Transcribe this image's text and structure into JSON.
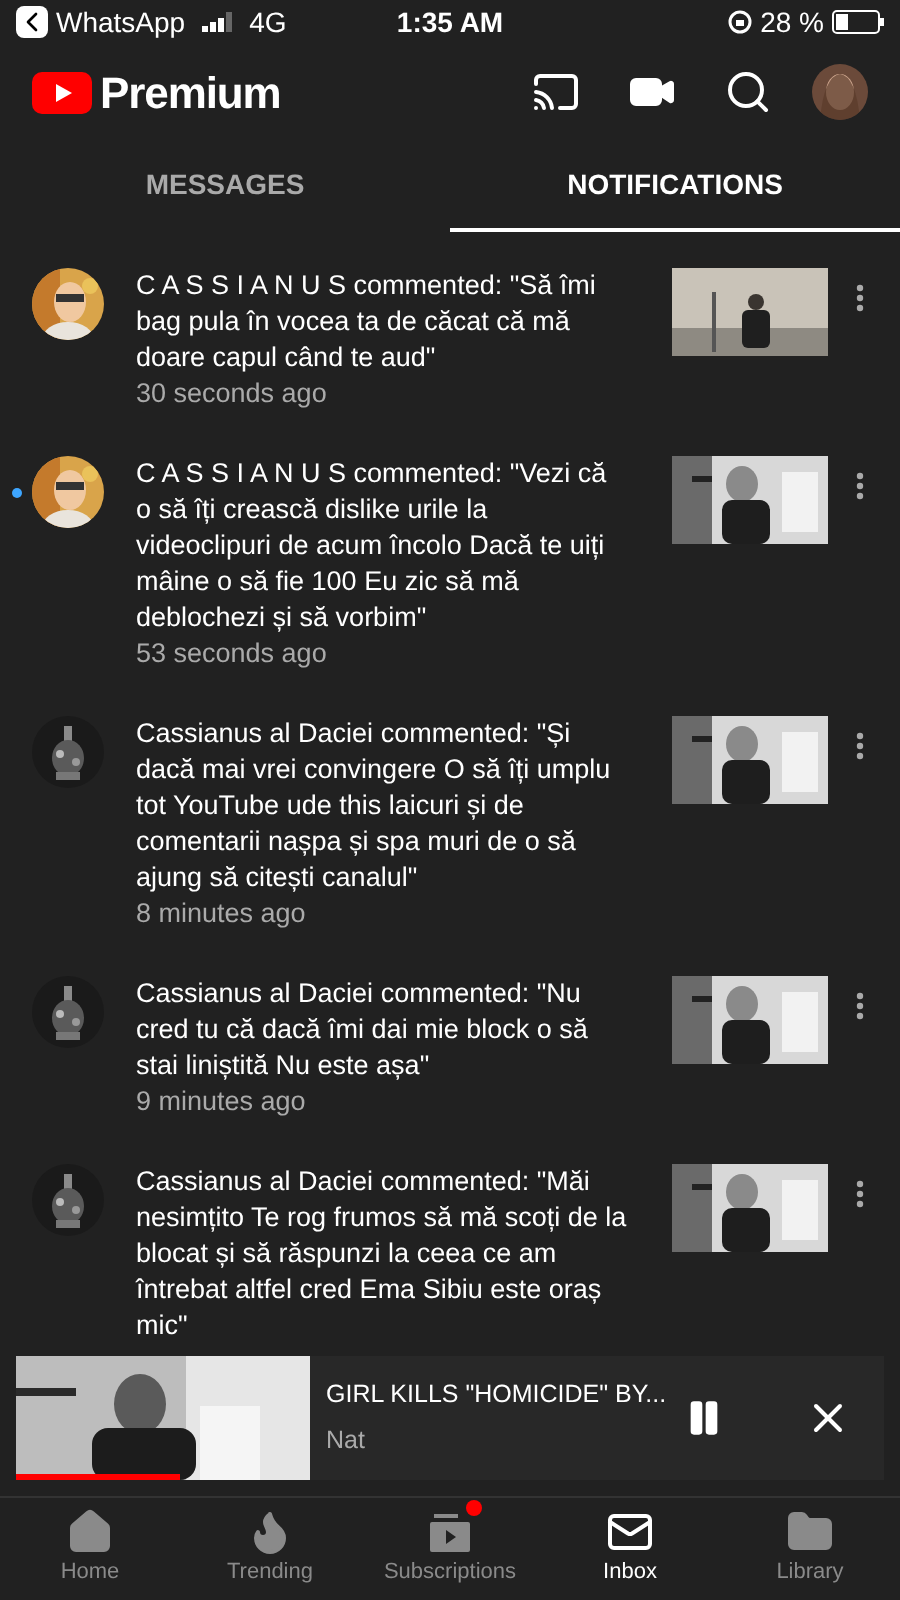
{
  "status_bar": {
    "back_app": "WhatsApp",
    "network": "4G",
    "time": "1:35 AM",
    "battery": "28 %"
  },
  "header": {
    "logo_text": "Premium"
  },
  "tabs": [
    {
      "label": "MESSAGES",
      "selected": false
    },
    {
      "label": "NOTIFICATIONS",
      "selected": true
    }
  ],
  "notifications": [
    {
      "author": "C A S S I A N U S",
      "text": " commented: \"Să îmi bag pula în vocea ta de căcat că mă doare capul când te aud\"",
      "time": "30 seconds ago",
      "unread": false
    },
    {
      "author": "C A S S I A N U S",
      "text": " commented: \"Vezi că o să îți crească dislike urile la videoclipuri de acum încolo Dacă te uiți mâine o să fie 100 Eu zic să mă deblochezi și să vorbim\"",
      "time": "53 seconds ago",
      "unread": true
    },
    {
      "author": "Cassianus al Daciei",
      "text": " commented: \"Și dacă mai vrei convingere O să îți umplu tot YouTube ude this laicuri și de comentarii nașpa și spa muri de o să ajung să citești canalul\"",
      "time": "8 minutes ago",
      "unread": false
    },
    {
      "author": "Cassianus al Daciei",
      "text": " commented: \"Nu cred tu că dacă îmi dai mie block o să stai liniștită Nu este așa\"",
      "time": "9 minutes ago",
      "unread": false
    },
    {
      "author": "Cassianus al Daciei",
      "text": " commented: \"Măi nesimțito Te rog frumos să mă scoți de la blocat și să răspunzi la ceea ce am întrebat altfel cred Ema Sibiu este oraș mic\"",
      "unread": false
    }
  ],
  "mini_player": {
    "title": "GIRL KILLS \"HOMICIDE\" BY...",
    "channel": "Nat"
  },
  "bottom_nav": [
    {
      "label": "Home",
      "selected": false,
      "badge": false
    },
    {
      "label": "Trending",
      "selected": false,
      "badge": false
    },
    {
      "label": "Subscriptions",
      "selected": false,
      "badge": true
    },
    {
      "label": "Inbox",
      "selected": true,
      "badge": false
    },
    {
      "label": "Library",
      "selected": false,
      "badge": false
    }
  ]
}
